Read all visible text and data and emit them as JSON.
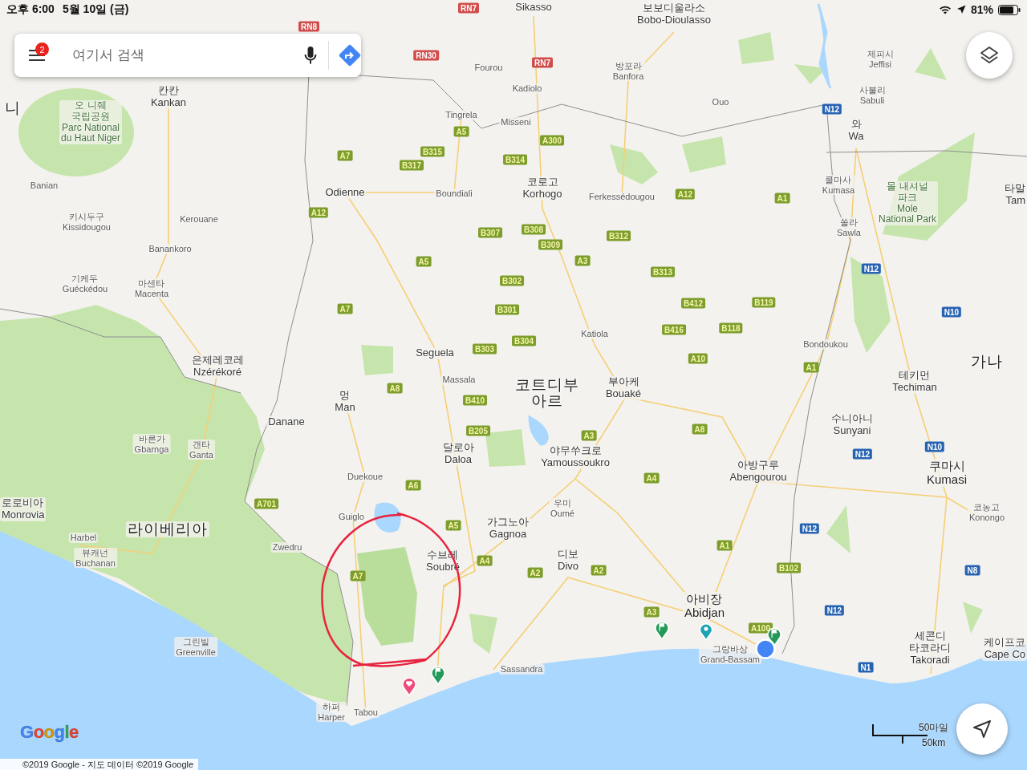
{
  "status_bar": {
    "time": "오후 6:00",
    "date": "5월 10일 (금)",
    "battery": "81%"
  },
  "search": {
    "badge": "2",
    "placeholder": "여기서 검색"
  },
  "places": [
    {
      "lines": [
        "니"
      ],
      "kind": "country"
    },
    {
      "lines": [
        "오 니줴",
        "국립공원",
        "Parc National",
        "du Haut Niger"
      ],
      "kind": "park"
    },
    {
      "lines": [
        "칸칸",
        "Kankan"
      ],
      "kind": "city"
    },
    {
      "lines": [
        "Banian"
      ],
      "kind": "town"
    },
    {
      "lines": [
        "키시두구",
        "Kissidougou"
      ],
      "kind": "town"
    },
    {
      "lines": [
        "Kerouane"
      ],
      "kind": "town"
    },
    {
      "lines": [
        "Banankoro"
      ],
      "kind": "town"
    },
    {
      "lines": [
        "기케두",
        "Guéckédou"
      ],
      "kind": "town"
    },
    {
      "lines": [
        "마센타",
        "Macenta"
      ],
      "kind": "town"
    },
    {
      "lines": [
        "은제레코레",
        "Nzérékoré"
      ],
      "kind": "city"
    },
    {
      "lines": [
        "Sikasso"
      ],
      "kind": "city"
    },
    {
      "lines": [
        "보보디울라소",
        "Bobo-Dioulasso"
      ],
      "kind": "city"
    },
    {
      "lines": [
        "Fourou"
      ],
      "kind": "town"
    },
    {
      "lines": [
        "방포라",
        "Banfora"
      ],
      "kind": "town"
    },
    {
      "lines": [
        "Kadiolo"
      ],
      "kind": "town"
    },
    {
      "lines": [
        "Tingrela"
      ],
      "kind": "town"
    },
    {
      "lines": [
        "Misseni"
      ],
      "kind": "town"
    },
    {
      "lines": [
        "Ouo"
      ],
      "kind": "town"
    },
    {
      "lines": [
        "제피시",
        "Jeffisi"
      ],
      "kind": "town"
    },
    {
      "lines": [
        "사불리",
        "Sabuli"
      ],
      "kind": "town"
    },
    {
      "lines": [
        "와",
        "Wa"
      ],
      "kind": "city"
    },
    {
      "lines": [
        "Odienne"
      ],
      "kind": "city"
    },
    {
      "lines": [
        "Boundiali"
      ],
      "kind": "town"
    },
    {
      "lines": [
        "코로고",
        "Korhogo"
      ],
      "kind": "city"
    },
    {
      "lines": [
        "Ferkessédougou"
      ],
      "kind": "town"
    },
    {
      "lines": [
        "쿨마사",
        "Kumasa"
      ],
      "kind": "town"
    },
    {
      "lines": [
        "몰 내셔널",
        "파크",
        "Mole",
        "National Park"
      ],
      "kind": "park"
    },
    {
      "lines": [
        "타말",
        "Tam"
      ],
      "kind": "edge-right"
    },
    {
      "lines": [
        "쏠라",
        "Sawla"
      ],
      "kind": "town"
    },
    {
      "lines": [
        "Katiola"
      ],
      "kind": "town"
    },
    {
      "lines": [
        "Bondoukou"
      ],
      "kind": "town"
    },
    {
      "lines": [
        "가나"
      ],
      "kind": "country"
    },
    {
      "lines": [
        "Seguela"
      ],
      "kind": "city"
    },
    {
      "lines": [
        "Massala"
      ],
      "kind": "town"
    },
    {
      "lines": [
        "코트디부",
        "아르"
      ],
      "kind": "country"
    },
    {
      "lines": [
        "부아케",
        "Bouaké"
      ],
      "kind": "city"
    },
    {
      "lines": [
        "테키먼",
        "Techiman"
      ],
      "kind": "city"
    },
    {
      "lines": [
        "멍",
        "Man"
      ],
      "kind": "city"
    },
    {
      "lines": [
        "Danane"
      ],
      "kind": "city"
    },
    {
      "lines": [
        "바른가",
        "Gbarnga"
      ],
      "kind": "town"
    },
    {
      "lines": [
        "갠타",
        "Ganta"
      ],
      "kind": "town"
    },
    {
      "lines": [
        "수니아니",
        "Sunyani"
      ],
      "kind": "city"
    },
    {
      "lines": [
        "달로아",
        "Daloa"
      ],
      "kind": "city"
    },
    {
      "lines": [
        "야무쑤크로",
        "Yamoussoukro"
      ],
      "kind": "city"
    },
    {
      "lines": [
        "Duekoue"
      ],
      "kind": "town"
    },
    {
      "lines": [
        "아방구루",
        "Abengourou"
      ],
      "kind": "city"
    },
    {
      "lines": [
        "쿠마시",
        "Kumasi"
      ],
      "kind": "major"
    },
    {
      "lines": [
        "로로비아",
        "Monrovia"
      ],
      "kind": "edge-left"
    },
    {
      "lines": [
        "Harbel"
      ],
      "kind": "town"
    },
    {
      "lines": [
        "라이베리아"
      ],
      "kind": "country"
    },
    {
      "lines": [
        "Guiglo"
      ],
      "kind": "town"
    },
    {
      "lines": [
        "가그노아",
        "Gagnoa"
      ],
      "kind": "city"
    },
    {
      "lines": [
        "우미",
        "Oumé"
      ],
      "kind": "town"
    },
    {
      "lines": [
        "코농고",
        "Konongo"
      ],
      "kind": "town"
    },
    {
      "lines": [
        "뷰캐넌",
        "Buchanan"
      ],
      "kind": "town"
    },
    {
      "lines": [
        "Zwedru"
      ],
      "kind": "town"
    },
    {
      "lines": [
        "수브레",
        "Soubré"
      ],
      "kind": "city"
    },
    {
      "lines": [
        "디보",
        "Divo"
      ],
      "kind": "city"
    },
    {
      "lines": [
        "아비장",
        "Abidjan"
      ],
      "kind": "major"
    },
    {
      "lines": [
        "그린빌",
        "Greenville"
      ],
      "kind": "town"
    },
    {
      "lines": [
        "Sassandra"
      ],
      "kind": "town"
    },
    {
      "lines": [
        "그랑바상",
        "Grand-Bassam"
      ],
      "kind": "town"
    },
    {
      "lines": [
        "세콘디",
        "타코라디",
        "Takoradi"
      ],
      "kind": "city"
    },
    {
      "lines": [
        "케이프코",
        "Cape Co"
      ],
      "kind": "edge-right"
    },
    {
      "lines": [
        "하퍼",
        "Harper"
      ],
      "kind": "town"
    },
    {
      "lines": [
        "Tabou"
      ],
      "kind": "town"
    }
  ],
  "roads": [
    {
      "label": "RN7",
      "kind": "rn"
    },
    {
      "label": "RN8",
      "kind": "rn"
    },
    {
      "label": "RN30",
      "kind": "rn"
    },
    {
      "label": "RN7",
      "kind": "rn"
    },
    {
      "label": "A5",
      "kind": "ci"
    },
    {
      "label": "A300",
      "kind": "ci"
    },
    {
      "label": "B315",
      "kind": "ci"
    },
    {
      "label": "B314",
      "kind": "ci"
    },
    {
      "label": "A7",
      "kind": "ci"
    },
    {
      "label": "B317",
      "kind": "ci"
    },
    {
      "label": "A12",
      "kind": "ci"
    },
    {
      "label": "A1",
      "kind": "ci"
    },
    {
      "label": "A12",
      "kind": "ci"
    },
    {
      "label": "B307",
      "kind": "ci"
    },
    {
      "label": "B308",
      "kind": "ci"
    },
    {
      "label": "B309",
      "kind": "ci"
    },
    {
      "label": "B312",
      "kind": "ci"
    },
    {
      "label": "A3",
      "kind": "ci"
    },
    {
      "label": "A5",
      "kind": "ci"
    },
    {
      "label": "B313",
      "kind": "ci"
    },
    {
      "label": "B302",
      "kind": "ci"
    },
    {
      "label": "B412",
      "kind": "ci"
    },
    {
      "label": "B119",
      "kind": "ci"
    },
    {
      "label": "A7",
      "kind": "ci"
    },
    {
      "label": "B301",
      "kind": "ci"
    },
    {
      "label": "B416",
      "kind": "ci"
    },
    {
      "label": "B118",
      "kind": "ci"
    },
    {
      "label": "B303",
      "kind": "ci"
    },
    {
      "label": "B304",
      "kind": "ci"
    },
    {
      "label": "A10",
      "kind": "ci"
    },
    {
      "label": "A1",
      "kind": "ci"
    },
    {
      "label": "A8",
      "kind": "ci"
    },
    {
      "label": "B410",
      "kind": "ci"
    },
    {
      "label": "B205",
      "kind": "ci"
    },
    {
      "label": "A3",
      "kind": "ci"
    },
    {
      "label": "A8",
      "kind": "ci"
    },
    {
      "label": "A6",
      "kind": "ci"
    },
    {
      "label": "A4",
      "kind": "ci"
    },
    {
      "label": "A701",
      "kind": "ci"
    },
    {
      "label": "A5",
      "kind": "ci"
    },
    {
      "label": "A4",
      "kind": "ci"
    },
    {
      "label": "A7",
      "kind": "ci"
    },
    {
      "label": "A2",
      "kind": "ci"
    },
    {
      "label": "A2",
      "kind": "ci"
    },
    {
      "label": "A1",
      "kind": "ci"
    },
    {
      "label": "B102",
      "kind": "ci"
    },
    {
      "label": "A3",
      "kind": "ci"
    },
    {
      "label": "A100",
      "kind": "ci"
    },
    {
      "label": "N12",
      "kind": "n"
    },
    {
      "label": "N12",
      "kind": "n"
    },
    {
      "label": "N10",
      "kind": "n"
    },
    {
      "label": "N10",
      "kind": "n"
    },
    {
      "label": "N12",
      "kind": "n"
    },
    {
      "label": "N12",
      "kind": "n"
    },
    {
      "label": "N8",
      "kind": "n"
    },
    {
      "label": "N12",
      "kind": "n"
    },
    {
      "label": "N1",
      "kind": "n"
    }
  ],
  "scale": {
    "miles": "50마일",
    "km": "50km"
  },
  "logo": "Google",
  "attribution": "©2019 Google - 지도 데이터 ©2019 Google"
}
